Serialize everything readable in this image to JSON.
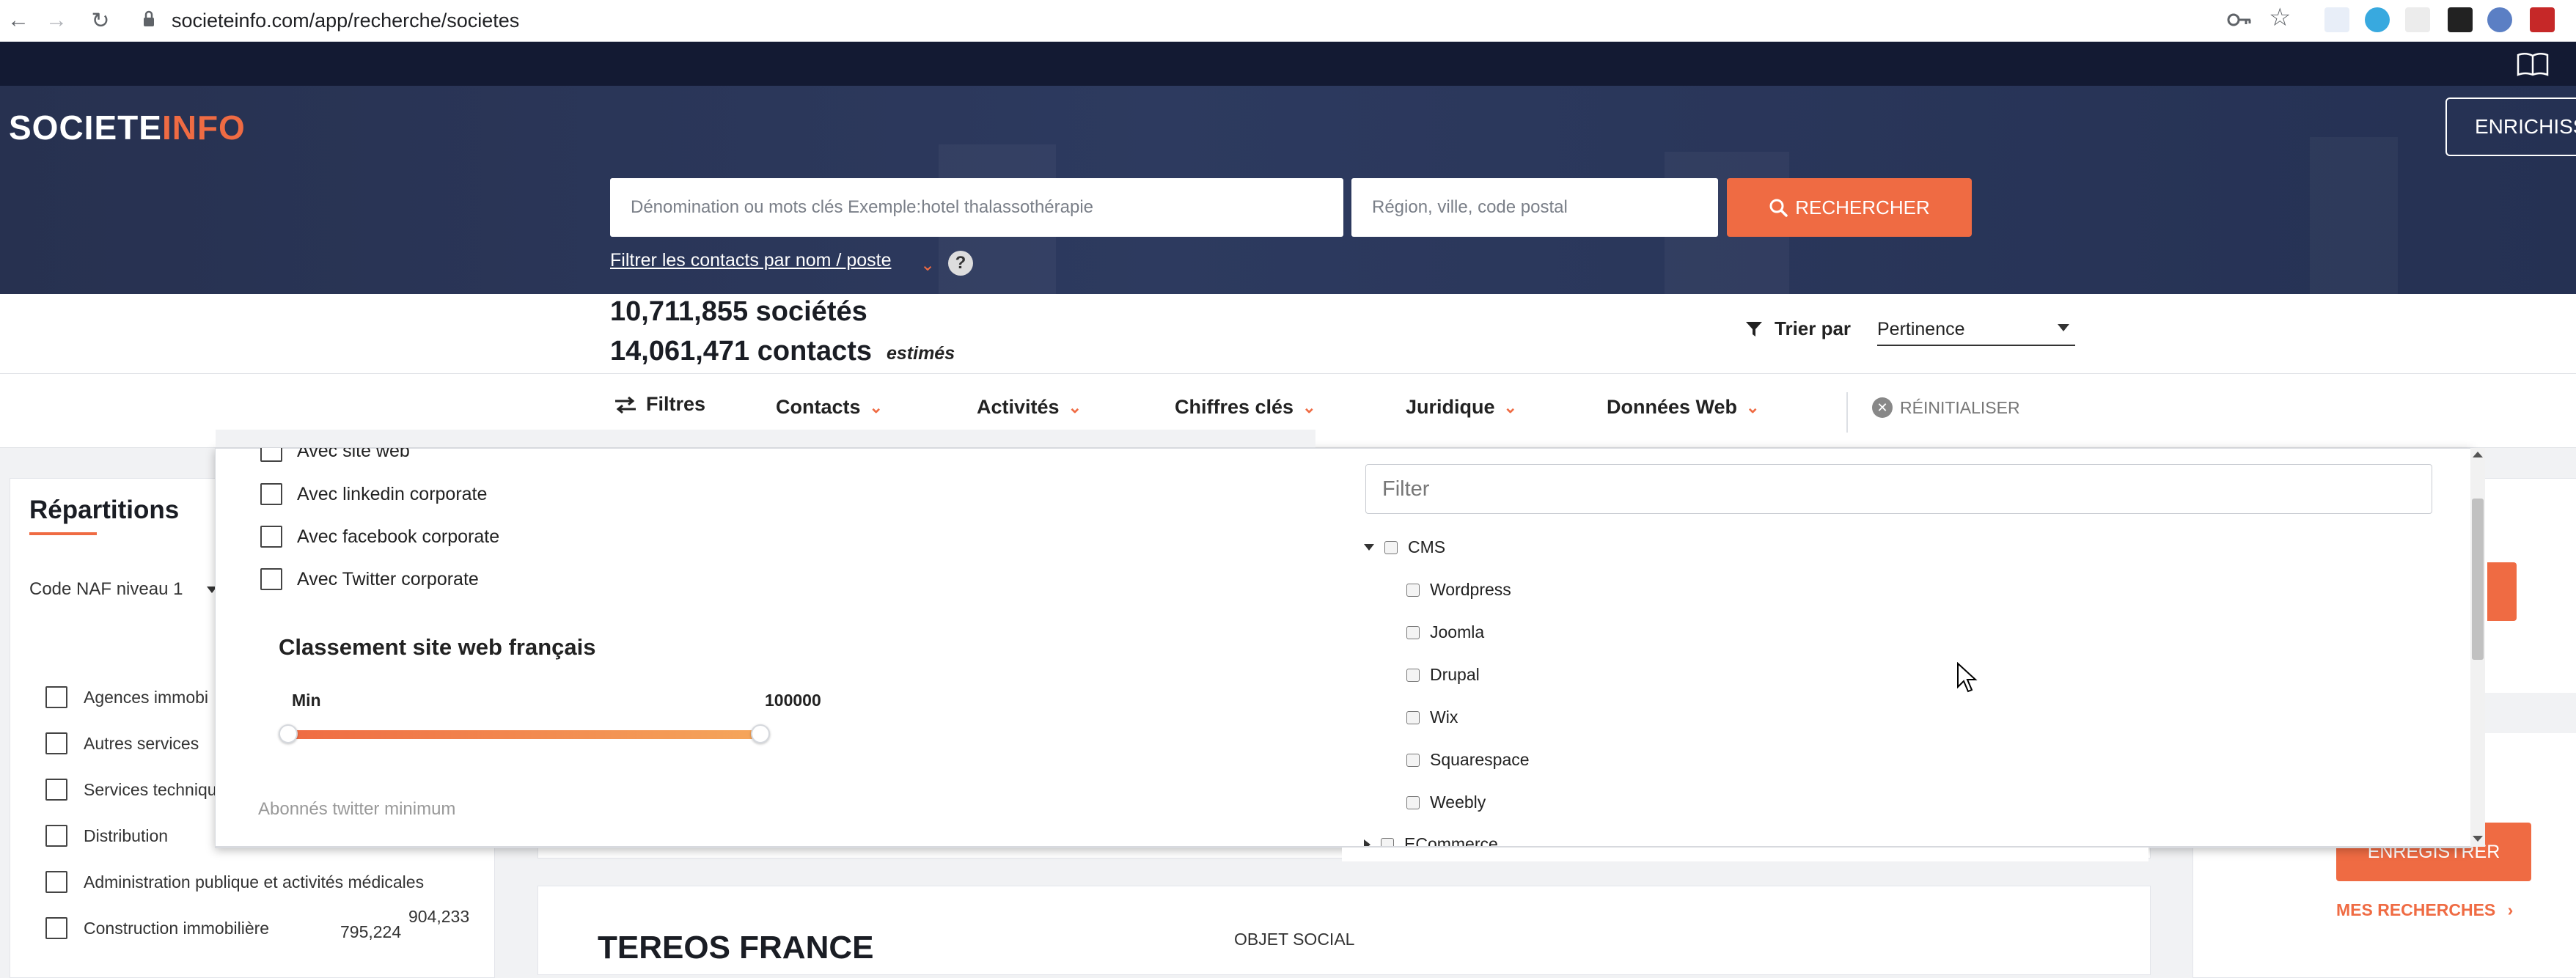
{
  "browser": {
    "url": "societeinfo.com/app/recherche/societes"
  },
  "header": {
    "logo_part1": "SOCIETE",
    "logo_part2": "INFO",
    "enrich_label": "ENRICHISS"
  },
  "search": {
    "query_placeholder": "Dénomination ou mots clés Exemple:hotel thalassothérapie",
    "region_placeholder": "Région, ville, code postal",
    "button_label": "RECHERCHER",
    "filter_contacts_link": "Filtrer les contacts par nom / poste",
    "help_label": "?"
  },
  "summary": {
    "societes": "10,711,855 sociétés",
    "contacts": "14,061,471 contacts",
    "estimes": "estimés",
    "sort_label": "Trier par",
    "sort_value": "Pertinence"
  },
  "tabs": {
    "filtres": "Filtres",
    "contacts": "Contacts",
    "activites": "Activités",
    "chiffres": "Chiffres clés",
    "juridique": "Juridique",
    "donnees_web": "Données Web",
    "reset": "RÉINITIALISER"
  },
  "repartitions": {
    "title": "Répartitions",
    "select_value": "Code NAF niveau 1",
    "rows": [
      {
        "label": "Agences immobi",
        "value": ""
      },
      {
        "label": "Autres services",
        "value": ""
      },
      {
        "label": "Services techniqu",
        "value": ""
      },
      {
        "label": "Distribution",
        "value": ""
      },
      {
        "label": "Administration publique et activités médicales",
        "value": ""
      },
      {
        "label": "Construction immobilière",
        "value": "795,224"
      }
    ],
    "extra_value": "904,233"
  },
  "web_filters": {
    "checkboxes": [
      {
        "label": "Avec site web",
        "checked": false
      },
      {
        "label": "Avec linkedin corporate",
        "checked": false
      },
      {
        "label": "Avec facebook corporate",
        "checked": false
      },
      {
        "label": "Avec Twitter corporate",
        "checked": false
      }
    ],
    "ranking_title": "Classement site web français",
    "ranking_min_label": "Min",
    "ranking_max_label": "100000",
    "twitter_min_label": "Abonnés twitter minimum"
  },
  "tech_tree": {
    "filter_placeholder": "Filter",
    "groups": [
      {
        "label": "CMS",
        "expanded": true,
        "children": [
          "Wordpress",
          "Joomla",
          "Drupal",
          "Wix",
          "Squarespace",
          "Weebly"
        ]
      },
      {
        "label": "ECommerce",
        "expanded": false,
        "children": []
      }
    ]
  },
  "results": {
    "company_title": "TEREOS FRANCE",
    "objet_social": "OBJET SOCIAL"
  },
  "right_panel": {
    "save_label": "ENREGISTRER",
    "mes_recherches": "MES RECHERCHES"
  },
  "colors": {
    "accent": "#ef6b43",
    "hero": "#2d3a5f",
    "topbar": "#131a33"
  }
}
